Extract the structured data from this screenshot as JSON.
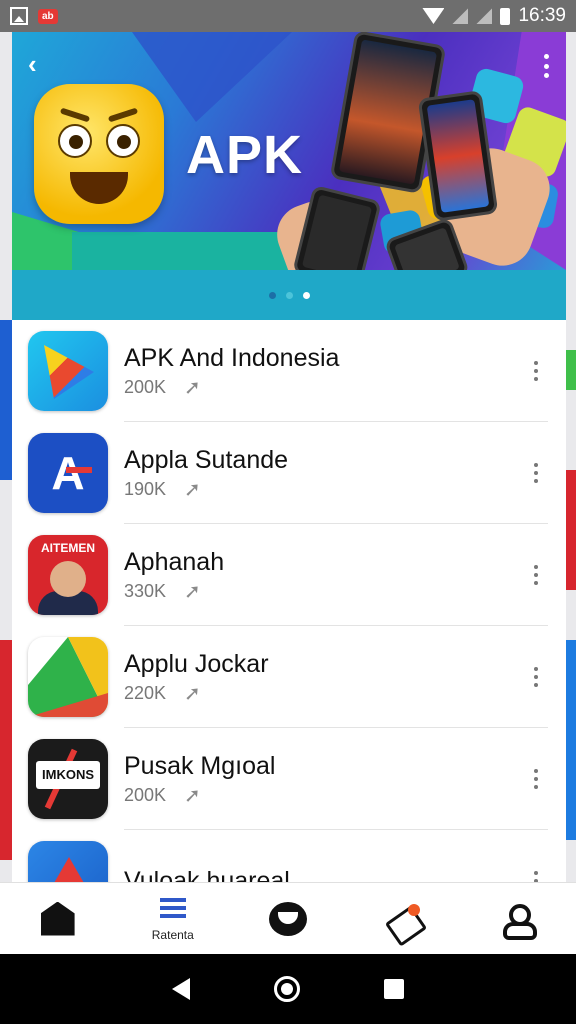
{
  "status_bar": {
    "time": "16:39",
    "badge": "ab"
  },
  "banner": {
    "title": "APK",
    "pages": 3,
    "active_page": 3
  },
  "apps": [
    {
      "title": "APK And Indonesia",
      "count": "200K",
      "icon": "colorful-triangle-icon"
    },
    {
      "title": "Appla Sutande",
      "count": "190K",
      "icon": "blue-letter-icon"
    },
    {
      "title": "Aphanah",
      "count": "330K",
      "icon": "red-poster-icon",
      "icon_text": "AITEMEN"
    },
    {
      "title": "Applu Jockar",
      "count": "220K",
      "icon": "green-drive-icon"
    },
    {
      "title": "Pusak Mgıoal",
      "count": "200K",
      "icon": "black-plate-icon",
      "icon_text": "IMKONS"
    },
    {
      "title": "Vuloak huareal",
      "count": "",
      "icon": "blue-red-triangle-icon"
    }
  ],
  "bottom_nav": {
    "items": [
      {
        "icon": "home-icon",
        "label": ""
      },
      {
        "icon": "chevrons-icon",
        "label": "Ratenta"
      },
      {
        "icon": "chat-icon",
        "label": ""
      },
      {
        "icon": "tag-icon",
        "label": ""
      },
      {
        "icon": "profile-icon",
        "label": ""
      }
    ]
  },
  "colors": {
    "accent": "#2f58c9",
    "pager_bg": "#1fa8c8",
    "text": "#111111",
    "muted": "#777777"
  }
}
